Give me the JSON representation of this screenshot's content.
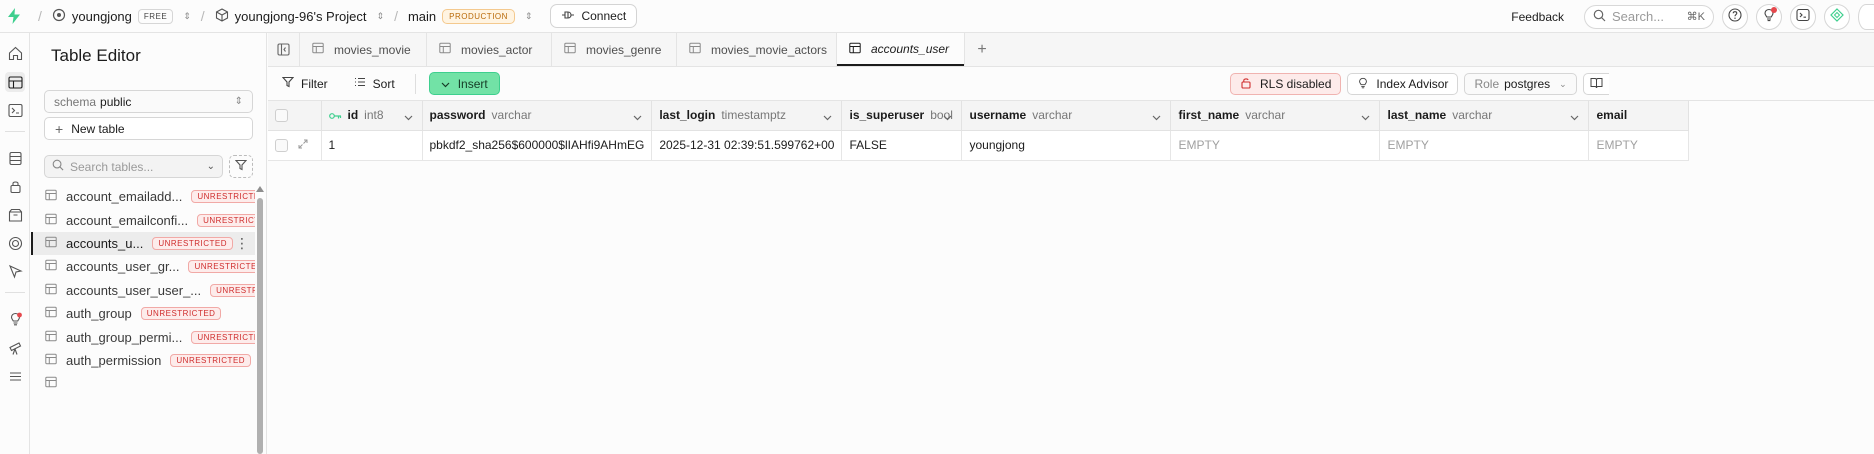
{
  "topbar": {
    "org_name": "youngjong",
    "org_plan": "FREE",
    "project_name": "youngjong-96's Project",
    "branch_name": "main",
    "branch_env": "PRODUCTION",
    "connect_label": "Connect",
    "feedback_label": "Feedback",
    "search_placeholder": "Search...",
    "search_shortcut": "⌘K"
  },
  "sidebar": {
    "title": "Table Editor",
    "schema_label": "schema",
    "schema_value": "public",
    "new_table_label": "New table",
    "search_placeholder": "Search tables...",
    "items": [
      {
        "name": "account_emailadd...",
        "badge": "UNRESTRICTED",
        "active": false
      },
      {
        "name": "account_emailconfi...",
        "badge": "UNRESTRICTED",
        "active": false
      },
      {
        "name": "accounts_u...",
        "badge": "UNRESTRICTED",
        "active": true
      },
      {
        "name": "accounts_user_gr...",
        "badge": "UNRESTRICTED",
        "active": false
      },
      {
        "name": "accounts_user_user_...",
        "badge": "UNRESTRIC",
        "active": false
      },
      {
        "name": "auth_group",
        "badge": "UNRESTRICTED",
        "active": false
      },
      {
        "name": "auth_group_permi...",
        "badge": "UNRESTRICTED",
        "active": false
      },
      {
        "name": "auth_permission",
        "badge": "UNRESTRICTED",
        "active": false
      },
      {
        "name": "",
        "badge": "",
        "active": false
      }
    ]
  },
  "tabs": [
    {
      "label": "movies_movie",
      "active": false
    },
    {
      "label": "movies_actor",
      "active": false
    },
    {
      "label": "movies_genre",
      "active": false
    },
    {
      "label": "movies_movie_actors",
      "active": false
    },
    {
      "label": "accounts_user",
      "active": true
    }
  ],
  "toolbar": {
    "filter_label": "Filter",
    "sort_label": "Sort",
    "insert_label": "Insert",
    "rls_label": "RLS disabled",
    "index_advisor_label": "Index Advisor",
    "role_label": "Role",
    "role_value": "postgres"
  },
  "grid": {
    "columns": [
      {
        "name": "id",
        "type": "int8",
        "key": true
      },
      {
        "name": "password",
        "type": "varchar"
      },
      {
        "name": "last_login",
        "type": "timestamptz"
      },
      {
        "name": "is_superuser",
        "type": "bool"
      },
      {
        "name": "username",
        "type": "varchar"
      },
      {
        "name": "first_name",
        "type": "varchar"
      },
      {
        "name": "last_name",
        "type": "varchar"
      },
      {
        "name": "email",
        "type": ""
      }
    ],
    "rows": [
      [
        "1",
        "pbkdf2_sha256$600000$lIAHfi9AHmEG",
        "2025-12-31 02:39:51.599762+00",
        "FALSE",
        "youngjong",
        "EMPTY",
        "EMPTY",
        "EMPTY"
      ]
    ]
  },
  "colors": {
    "brand_green": "#3ecf8e",
    "insert_bg": "#72e2a6",
    "warning_red": "#cf2d2d",
    "production_orange": "#b96a09"
  }
}
